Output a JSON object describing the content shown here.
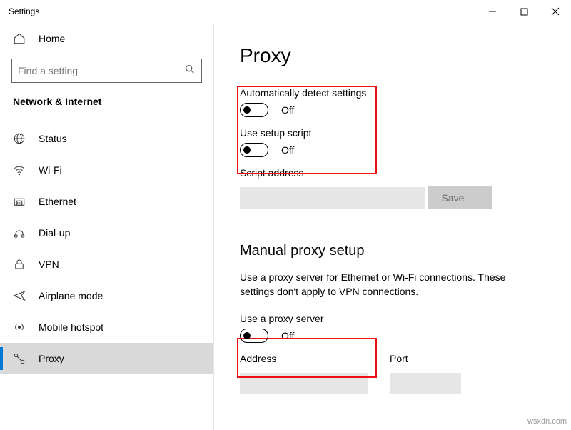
{
  "window": {
    "title": "Settings"
  },
  "sidebar": {
    "home": "Home",
    "search_placeholder": "Find a setting",
    "section": "Network & Internet",
    "items": [
      {
        "label": "Status"
      },
      {
        "label": "Wi-Fi"
      },
      {
        "label": "Ethernet"
      },
      {
        "label": "Dial-up"
      },
      {
        "label": "VPN"
      },
      {
        "label": "Airplane mode"
      },
      {
        "label": "Mobile hotspot"
      },
      {
        "label": "Proxy"
      }
    ]
  },
  "main": {
    "title": "Proxy",
    "auto_detect": {
      "label": "Automatically detect settings",
      "state": "Off"
    },
    "setup_script": {
      "label": "Use setup script",
      "state": "Off"
    },
    "script_address_label": "Script address",
    "save_button": "Save",
    "manual_header": "Manual proxy setup",
    "manual_desc": "Use a proxy server for Ethernet or Wi-Fi connections. These settings don't apply to VPN connections.",
    "use_proxy": {
      "label": "Use a proxy server",
      "state": "Off"
    },
    "address_label": "Address",
    "port_label": "Port"
  },
  "watermark": "wsxdn.com"
}
